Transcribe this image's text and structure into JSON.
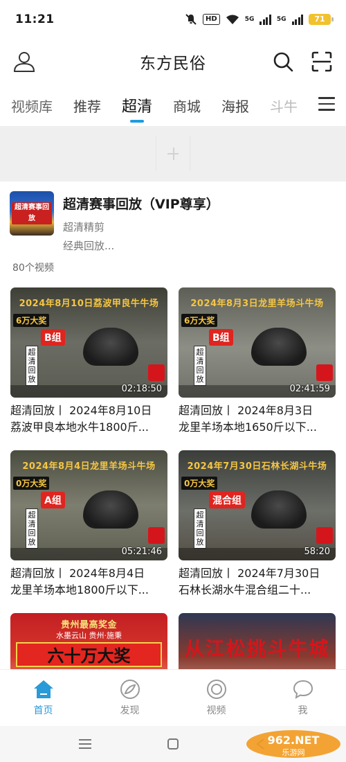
{
  "status": {
    "time": "11:21",
    "hd_badge": "HD",
    "net1": "5G",
    "net2": "5G",
    "battery": "71"
  },
  "header": {
    "title": "东方民俗"
  },
  "tabs": [
    {
      "label": "视频库"
    },
    {
      "label": "推荐"
    },
    {
      "label": "超清"
    },
    {
      "label": "商城"
    },
    {
      "label": "海报"
    },
    {
      "label": "斗牛"
    }
  ],
  "album": {
    "cover_text": "超清赛事回放",
    "title": "超清赛事回放（VIP尊享）",
    "subtitle": "超清精剪",
    "description": "经典回放..."
  },
  "video_count": "80个视频",
  "videos": [
    {
      "thumb_title": "2024年8月10日荔波甲良牛牛场",
      "prize": "6万大奖",
      "group": "B组",
      "replay": "超清回放",
      "duration": "02:18:50",
      "title_l1": "超清回放丨 2024年8月10日",
      "title_l2": "荔波甲良本地水牛1800斤..."
    },
    {
      "thumb_title": "2024年8月3日龙里羊场斗牛场",
      "prize": "6万大奖",
      "group": "B组",
      "replay": "超清回放",
      "duration": "02:41:59",
      "title_l1": "超清回放丨 2024年8月3日",
      "title_l2": "龙里羊场本地1650斤以下..."
    },
    {
      "thumb_title": "2024年8月4日龙里羊场斗牛场",
      "prize": "0万大奖",
      "group": "A组",
      "replay": "超清回放",
      "duration": "05:21:46",
      "title_l1": "超清回放丨 2024年8月4日",
      "title_l2": "龙里羊场本地1800斤以下..."
    },
    {
      "thumb_title": "2024年7月30日石林长湖斗牛场",
      "prize": "0万大奖",
      "group": "混合组",
      "replay": "超清回放",
      "duration": "58:20",
      "title_l1": "超清回放丨 2024年7月30日",
      "title_l2": "石林长湖水牛混合组二十..."
    },
    {
      "thumb_title": "贵州最高奖金",
      "big_text": "六十万大奖",
      "sub_text": "水墨云山 贵州·施秉"
    },
    {
      "big_text": "从江松挑斗牛城"
    }
  ],
  "bottom_nav": [
    {
      "label": "首页",
      "icon": "home-icon",
      "active": true
    },
    {
      "label": "发现",
      "icon": "discover-icon",
      "active": false
    },
    {
      "label": "视频",
      "icon": "video-icon",
      "active": false
    },
    {
      "label": "我",
      "icon": "chat-icon",
      "active": false
    }
  ],
  "watermark": "962.NET 乐游网",
  "colors": {
    "accent": "#2a9ad8",
    "tab_indicator": "#1e9be0",
    "battery": "#f2c12e"
  }
}
